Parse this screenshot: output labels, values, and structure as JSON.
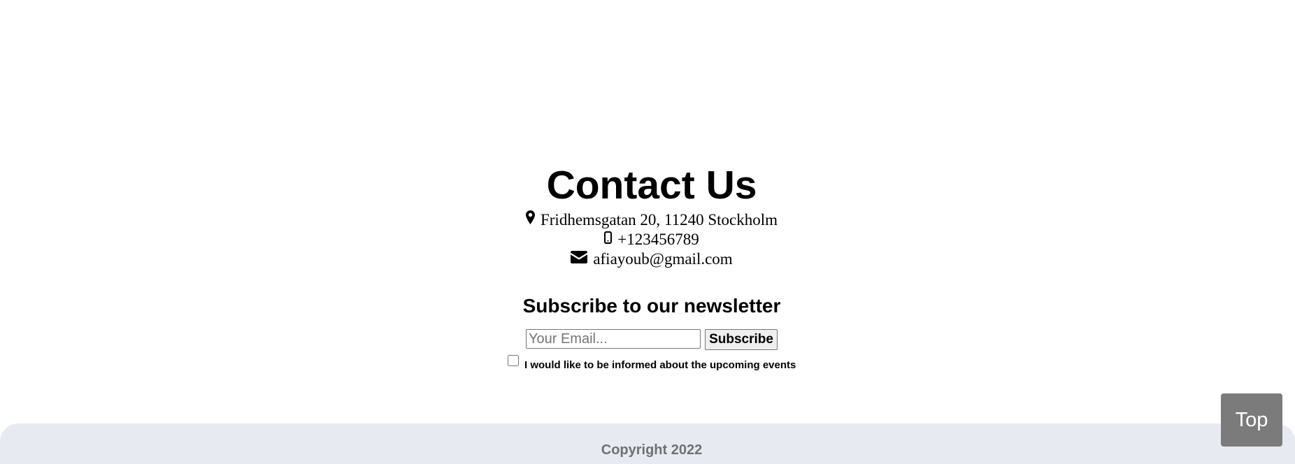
{
  "contact": {
    "title": "Contact Us",
    "address": "Fridhemsgatan 20, 11240 Stockholm",
    "phone": "+123456789",
    "email": "afiayoub@gmail.com"
  },
  "icons": {
    "address": "map-marker-icon",
    "phone": "mobile-phone-icon",
    "email": "envelope-icon"
  },
  "newsletter": {
    "title": "Subscribe to our newsletter",
    "email_placeholder": "Your Email...",
    "email_value": "",
    "subscribe_label": "Subscribe",
    "consent_label": "I would like to be informed about the upcoming events",
    "consent_checked": false
  },
  "footer": {
    "copyright": "Copyright 2022"
  },
  "top_button": {
    "label": "Top"
  },
  "colors": {
    "footer_background": "#e7ebf1",
    "copyright_text": "#707070",
    "top_button_background": "#7b7b7b",
    "top_button_text": "#ffffff"
  }
}
